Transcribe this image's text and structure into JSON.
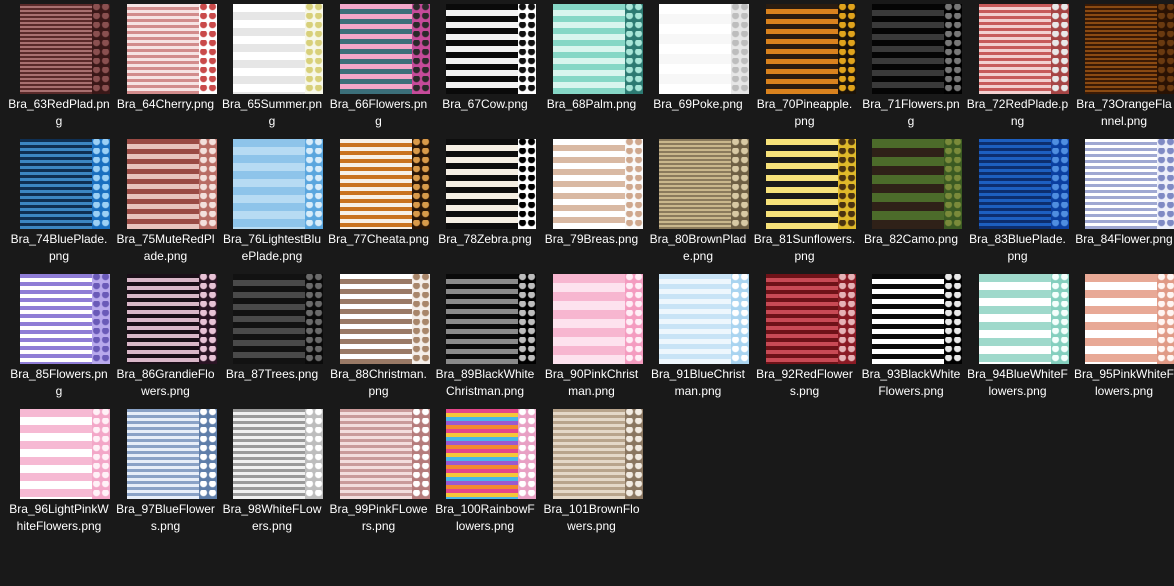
{
  "files": [
    {
      "name": "Bra_63RedPlad.png",
      "icon": "red-plaid-stripe-thumbnail-icon",
      "colors": [
        "#5a2a2a",
        "#a87070"
      ],
      "side": [
        "#3a1818",
        "#8a5050"
      ],
      "stripe": 2
    },
    {
      "name": "Bra_64Cherry.png",
      "icon": "cherry-stripe-thumbnail-icon",
      "colors": [
        "#f6e3e3",
        "#d28c8c"
      ],
      "side": [
        "#ffffff",
        "#c94a4a"
      ],
      "stripe": 3
    },
    {
      "name": "Bra_65Summer.png",
      "icon": "summer-stripe-thumbnail-icon",
      "colors": [
        "#ffffff",
        "#e6e6e6"
      ],
      "side": [
        "#f7f7e8",
        "#d8d07a"
      ],
      "stripe": 8
    },
    {
      "name": "Bra_66Flowers.png",
      "icon": "flowers-stripe-thumbnail-icon",
      "colors": [
        "#f2a7c9",
        "#3b6f7a"
      ],
      "side": [
        "#c64b9a",
        "#2a2a2a"
      ],
      "stripe": 5
    },
    {
      "name": "Bra_67Cow.png",
      "icon": "cow-stripe-thumbnail-icon",
      "colors": [
        "#0a0a0a",
        "#f2f2f2"
      ],
      "side": [
        "#ffffff",
        "#111111"
      ],
      "stripe": 6
    },
    {
      "name": "Bra_68Palm.png",
      "icon": "palm-stripe-thumbnail-icon",
      "colors": [
        "#86d7c6",
        "#d9f5ee"
      ],
      "side": [
        "#2c7a72",
        "#a8e6d8"
      ],
      "stripe": 6
    },
    {
      "name": "Bra_69Poke.png",
      "icon": "poke-stripe-thumbnail-icon",
      "colors": [
        "#ffffff",
        "#f7f7f7"
      ],
      "side": [
        "#e6e6e6",
        "#bdbdbd"
      ],
      "stripe": 10
    },
    {
      "name": "Bra_70Pineapple.png",
      "icon": "pineapple-stripe-thumbnail-icon",
      "colors": [
        "#2a1c10",
        "#d9821e"
      ],
      "side": [
        "#1a1209",
        "#e0a31c"
      ],
      "stripe": 5
    },
    {
      "name": "Bra_71Flowers.png",
      "icon": "black-flowers-stripe-thumbnail-icon",
      "colors": [
        "#050505",
        "#3a3a3a"
      ],
      "side": [
        "#000000",
        "#777777"
      ],
      "stripe": 6
    },
    {
      "name": "Bra_72RedPlade.png",
      "icon": "red-plade-stripe-thumbnail-icon",
      "colors": [
        "#c75b5b",
        "#f2d0d0"
      ],
      "side": [
        "#a64545",
        "#e8e8e8"
      ],
      "stripe": 3
    },
    {
      "name": "Bra_73OrangeFlannel.png",
      "icon": "orange-flannel-stripe-thumbnail-icon",
      "colors": [
        "#3a1a05",
        "#8a4a12"
      ],
      "side": [
        "#2a1203",
        "#6a3a10"
      ],
      "stripe": 2
    },
    {
      "name": "Bra_74BluePlade.png",
      "icon": "blue-plade-stripe-thumbnail-icon",
      "colors": [
        "#0f2f52",
        "#3c86c2"
      ],
      "side": [
        "#1a6fbf",
        "#9bd0f5"
      ],
      "stripe": 3
    },
    {
      "name": "Bra_75MuteRedPlade.png",
      "icon": "mute-red-plade-stripe-thumbnail-icon",
      "colors": [
        "#9a4a44",
        "#e8c2bc"
      ],
      "side": [
        "#b86c64",
        "#f3e0dc"
      ],
      "stripe": 5
    },
    {
      "name": "Bra_76LightestBluePlade.png",
      "icon": "lightest-blue-plade-stripe-thumbnail-icon",
      "colors": [
        "#8ec4ea",
        "#b7dbf3"
      ],
      "side": [
        "#5aa6de",
        "#d7ecfa"
      ],
      "stripe": 8
    },
    {
      "name": "Bra_77Cheata.png",
      "icon": "cheetah-stripe-thumbnail-icon",
      "colors": [
        "#f7f0e6",
        "#c9731f"
      ],
      "side": [
        "#2a1608",
        "#d99a4a"
      ],
      "stripe": 4
    },
    {
      "name": "Bra_78Zebra.png",
      "icon": "zebra-stripe-thumbnail-icon",
      "colors": [
        "#0d0d0d",
        "#f4eee3"
      ],
      "side": [
        "#ffffff",
        "#000000"
      ],
      "stripe": 6
    },
    {
      "name": "Bra_79Breas.png",
      "icon": "breast-stripe-thumbnail-icon",
      "colors": [
        "#ffffff",
        "#d9b9a3"
      ],
      "side": [
        "#fafafa",
        "#cfa88e"
      ],
      "stripe": 6
    },
    {
      "name": "Bra_80BrownPlade.png",
      "icon": "brown-plade-stripe-thumbnail-icon",
      "colors": [
        "#8a7a5c",
        "#c9b78c"
      ],
      "side": [
        "#6e5f44",
        "#d8c9a4"
      ],
      "stripe": 2
    },
    {
      "name": "Bra_81Sunflowers.png",
      "icon": "sunflowers-stripe-thumbnail-icon",
      "colors": [
        "#f7e27a",
        "#1a1a1a"
      ],
      "side": [
        "#e0b92a",
        "#4a3210"
      ],
      "stripe": 6
    },
    {
      "name": "Bra_82Camo.png",
      "icon": "camo-stripe-thumbnail-icon",
      "colors": [
        "#4c6b2a",
        "#2f2118"
      ],
      "side": [
        "#3b5a22",
        "#7a8a3a"
      ],
      "stripe": 9
    },
    {
      "name": "Bra_83BluePlade.png",
      "icon": "blue-plade-2-stripe-thumbnail-icon",
      "colors": [
        "#1d5fc0",
        "#0d2e6e"
      ],
      "side": [
        "#0b3fa0",
        "#4f8ee0"
      ],
      "stripe": 3
    },
    {
      "name": "Bra_84Flower.png",
      "icon": "flower-stripe-thumbnail-icon",
      "colors": [
        "#ffffff",
        "#9fa8d2"
      ],
      "side": [
        "#eef0fa",
        "#7f8ac4"
      ],
      "stripe": 3
    },
    {
      "name": "Bra_85Flowers.png",
      "icon": "purple-flowers-stripe-thumbnail-icon",
      "colors": [
        "#8f7dd6",
        "#ffffff"
      ],
      "side": [
        "#b8a9ec",
        "#6a5ab8"
      ],
      "stripe": 4
    },
    {
      "name": "Bra_86GrandieFlowers.png",
      "icon": "grandie-flowers-stripe-thumbnail-icon",
      "colors": [
        "#1a0f18",
        "#d9b7c8"
      ],
      "side": [
        "#2a1424",
        "#e8c3d6"
      ],
      "stripe": 4
    },
    {
      "name": "Bra_87Trees.png",
      "icon": "trees-stripe-thumbnail-icon",
      "colors": [
        "#121212",
        "#4a4a4a"
      ],
      "side": [
        "#0a0a0a",
        "#6a6a6a"
      ],
      "stripe": 6
    },
    {
      "name": "Bra_88Christman.png",
      "icon": "christmas-stripe-thumbnail-icon",
      "colors": [
        "#ffffff",
        "#9a7a66"
      ],
      "side": [
        "#f4eee9",
        "#a8866a"
      ],
      "stripe": 5
    },
    {
      "name": "Bra_89BlackWhiteChristman.png",
      "icon": "black-white-christmas-stripe-thumbnail-icon",
      "colors": [
        "#0a0a0a",
        "#8a8a8a"
      ],
      "side": [
        "#000000",
        "#bdbdbd"
      ],
      "stripe": 5
    },
    {
      "name": "Bra_90PinkChristman.png",
      "icon": "pink-christmas-stripe-thumbnail-icon",
      "colors": [
        "#f7b6d0",
        "#fde2ee"
      ],
      "side": [
        "#f49cc0",
        "#ffeef6"
      ],
      "stripe": 9
    },
    {
      "name": "Bra_91BlueChristman.png",
      "icon": "blue-christmas-stripe-thumbnail-icon",
      "colors": [
        "#c9e4f6",
        "#eef7fd"
      ],
      "side": [
        "#a9d4f0",
        "#ffffff"
      ],
      "stripe": 5
    },
    {
      "name": "Bra_92RedFlowers.png",
      "icon": "red-flowers-stripe-thumbnail-icon",
      "colors": [
        "#6e1218",
        "#c84a55"
      ],
      "side": [
        "#8a1a24",
        "#e6b2b6"
      ],
      "stripe": 4
    },
    {
      "name": "Bra_93BlackWhiteFlowers.png",
      "icon": "black-white-flowers-stripe-thumbnail-icon",
      "colors": [
        "#0a0a0a",
        "#ffffff"
      ],
      "side": [
        "#000000",
        "#e9e9e9"
      ],
      "stripe": 5
    },
    {
      "name": "Bra_94BlueWhiteFlowers.png",
      "icon": "blue-white-flowers-stripe-thumbnail-icon",
      "colors": [
        "#9fd9cb",
        "#ffffff"
      ],
      "side": [
        "#84cfbe",
        "#f4fffc"
      ],
      "stripe": 8
    },
    {
      "name": "Bra_95PinkWhiteFlowers.png",
      "icon": "pink-white-flowers-stripe-thumbnail-icon",
      "colors": [
        "#e8a996",
        "#ffffff"
      ],
      "side": [
        "#e09a86",
        "#fff5f2"
      ],
      "stripe": 8
    },
    {
      "name": "Bra_96LightPinkWhiteFlowers.png",
      "icon": "light-pink-white-flowers-stripe-thumbnail-icon",
      "colors": [
        "#f6b9d3",
        "#ffffff"
      ],
      "side": [
        "#f3a7c8",
        "#fff1f7"
      ],
      "stripe": 8
    },
    {
      "name": "Bra_97BlueFlowers.png",
      "icon": "blue-flowers-stripe-thumbnail-icon",
      "colors": [
        "#8aa2c6",
        "#e7eef8"
      ],
      "side": [
        "#5f7ea9",
        "#ffffff"
      ],
      "stripe": 3
    },
    {
      "name": "Bra_98WhiteFLowers.png",
      "icon": "white-flowers-stripe-thumbnail-icon",
      "colors": [
        "#9a9a9a",
        "#f0f0f0"
      ],
      "side": [
        "#bdbdbd",
        "#ffffff"
      ],
      "stripe": 3
    },
    {
      "name": "Bra_99PinkFLowers.png",
      "icon": "pink-flowers-stripe-thumbnail-icon",
      "colors": [
        "#c99a9a",
        "#f3dddd"
      ],
      "side": [
        "#b57c7c",
        "#ffffff"
      ],
      "stripe": 3
    },
    {
      "name": "Bra_100RainbowFlowers.png",
      "icon": "rainbow-flowers-stripe-thumbnail-icon",
      "colors": [
        "#e4468a",
        "#f5c73a",
        "#49b6e8",
        "#9b59d0",
        "#f28a2e"
      ],
      "side": [
        "#e8a0c4",
        "#ffffff"
      ],
      "stripe": 4
    },
    {
      "name": "Bra_101BrownFlowers.png",
      "icon": "brown-flowers-stripe-thumbnail-icon",
      "colors": [
        "#b8a48c",
        "#e4d8c8"
      ],
      "side": [
        "#8a7660",
        "#f2ebe2"
      ],
      "stripe": 3
    }
  ]
}
